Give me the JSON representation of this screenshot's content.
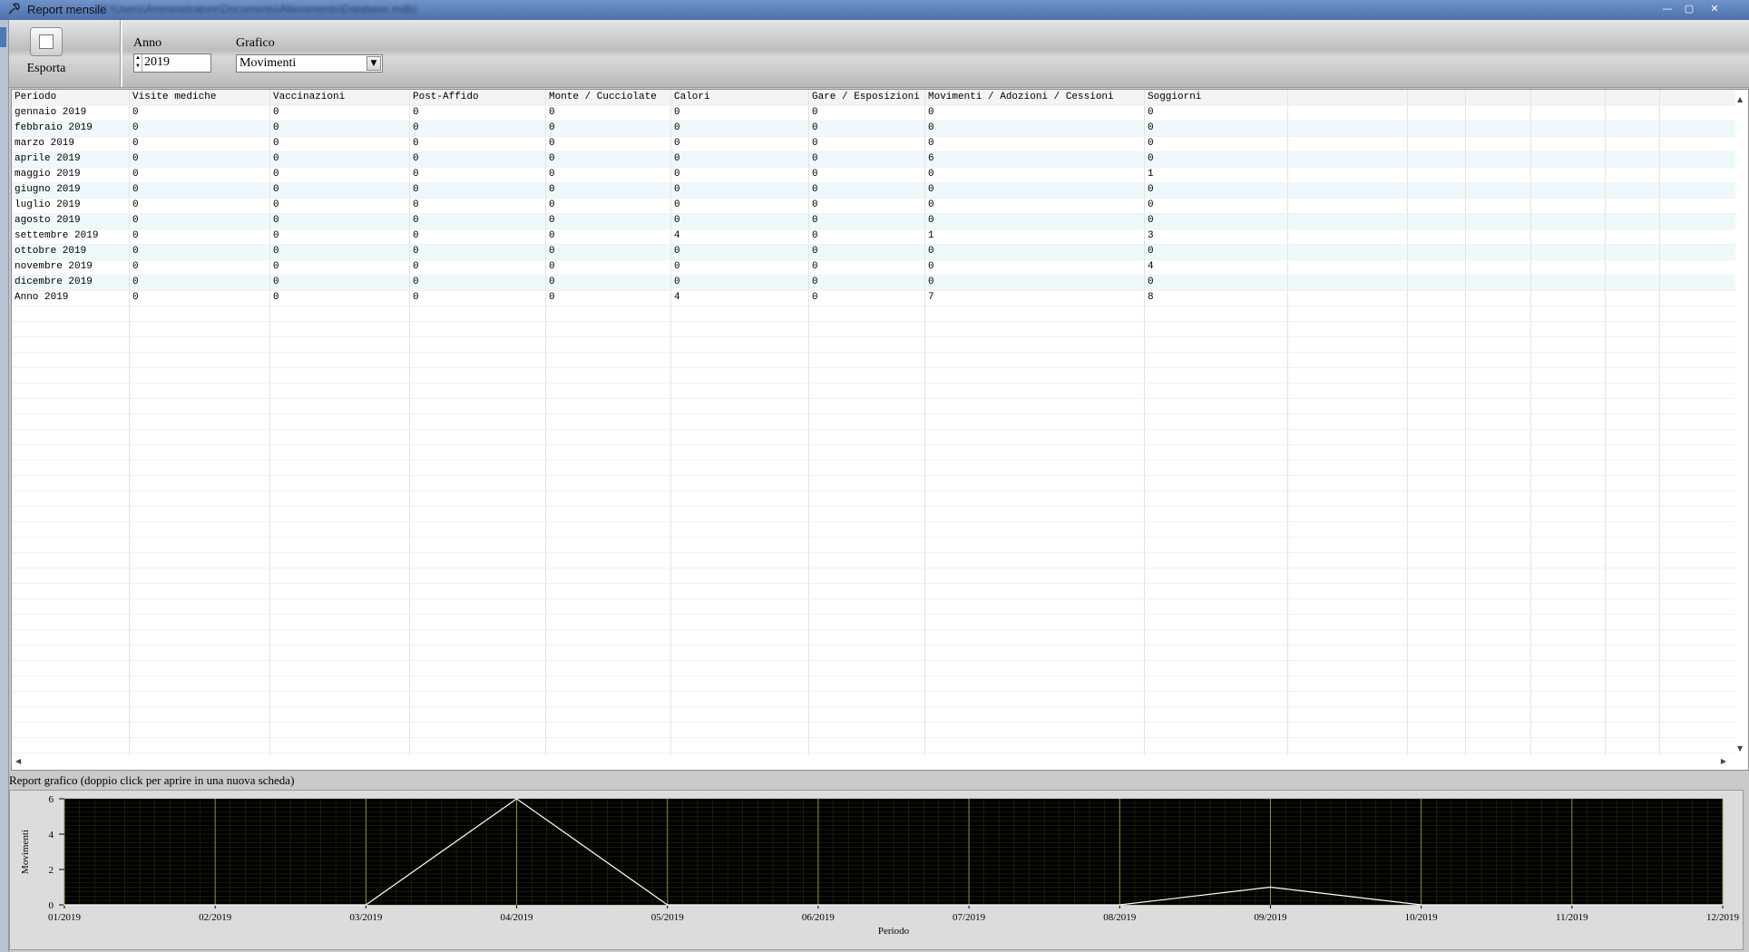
{
  "window": {
    "title": "Report mensile",
    "subtitle": "(C:\\Users\\Amministratore\\Documents\\Allevamento\\Database.mdb)",
    "minimize": "—",
    "maximize": "▢",
    "close": "✕"
  },
  "toolbar": {
    "export_label": "Esporta",
    "anno_label": "Anno",
    "anno_value": "2019",
    "grafico_label": "Grafico",
    "grafico_value": "Movimenti"
  },
  "grid": {
    "columns": [
      "Periodo",
      "Visite mediche",
      "Vaccinazioni",
      "Post-Affido",
      "Monte / Cucciolate",
      "Calori",
      "Gare / Esposizioni",
      "Movimenti / Adozioni / Cessioni",
      "Soggiorni"
    ],
    "rows": [
      [
        "gennaio 2019",
        "0",
        "0",
        "0",
        "0",
        "0",
        "0",
        "0",
        "0"
      ],
      [
        "febbraio 2019",
        "0",
        "0",
        "0",
        "0",
        "0",
        "0",
        "0",
        "0"
      ],
      [
        "marzo 2019",
        "0",
        "0",
        "0",
        "0",
        "0",
        "0",
        "0",
        "0"
      ],
      [
        "aprile 2019",
        "0",
        "0",
        "0",
        "0",
        "0",
        "0",
        "6",
        "0"
      ],
      [
        "maggio 2019",
        "0",
        "0",
        "0",
        "0",
        "0",
        "0",
        "0",
        "1"
      ],
      [
        "giugno 2019",
        "0",
        "0",
        "0",
        "0",
        "0",
        "0",
        "0",
        "0"
      ],
      [
        "luglio 2019",
        "0",
        "0",
        "0",
        "0",
        "0",
        "0",
        "0",
        "0"
      ],
      [
        "agosto 2019",
        "0",
        "0",
        "0",
        "0",
        "0",
        "0",
        "0",
        "0"
      ],
      [
        "settembre 2019",
        "0",
        "0",
        "0",
        "0",
        "4",
        "0",
        "1",
        "3"
      ],
      [
        "ottobre 2019",
        "0",
        "0",
        "0",
        "0",
        "0",
        "0",
        "0",
        "0"
      ],
      [
        "novembre 2019",
        "0",
        "0",
        "0",
        "0",
        "0",
        "0",
        "0",
        "4"
      ],
      [
        "dicembre 2019",
        "0",
        "0",
        "0",
        "0",
        "0",
        "0",
        "0",
        "0"
      ],
      [
        "Anno 2019",
        "0",
        "0",
        "0",
        "0",
        "4",
        "0",
        "7",
        "8"
      ]
    ]
  },
  "chart_caption": "Report grafico (doppio click per aprire in una nuova scheda)",
  "chart_data": {
    "type": "line",
    "x": [
      "01/2019",
      "02/2019",
      "03/2019",
      "04/2019",
      "05/2019",
      "06/2019",
      "07/2019",
      "08/2019",
      "09/2019",
      "10/2019",
      "11/2019",
      "12/2019"
    ],
    "series": [
      {
        "values": [
          0,
          0,
          0,
          6,
          0,
          0,
          0,
          0,
          1,
          0,
          0,
          0
        ]
      }
    ],
    "xlabel": "Periodo",
    "ylabel": "Movimenti",
    "ylim": [
      0,
      6
    ],
    "yticks": [
      0,
      2,
      4,
      6
    ],
    "grid": true,
    "background": "#000000",
    "line_color": "#ffffff",
    "grid_color": "#4d5a1a"
  }
}
